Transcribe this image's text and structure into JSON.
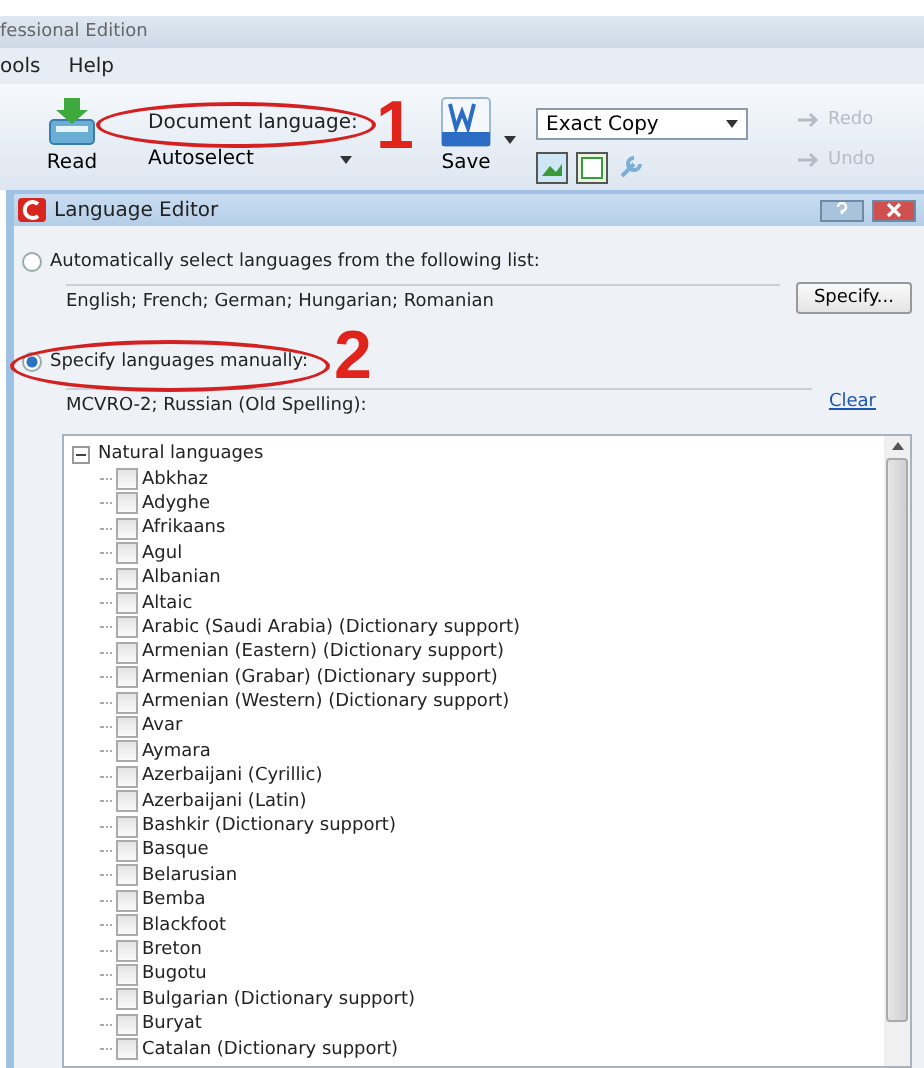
{
  "app_title": "fessional Edition",
  "menu": [
    {
      "label": "ools"
    },
    {
      "label": "Help"
    }
  ],
  "toolbar": {
    "read": {
      "label": "Read"
    },
    "language": {
      "label": "Document language:",
      "value": "Autoselect",
      "callout": "1"
    },
    "save": {
      "label": "Save"
    },
    "mode": {
      "value": "Exact Copy"
    },
    "history": [
      {
        "label": "Redo",
        "disabled": true
      },
      {
        "label": "Undo",
        "disabled": true
      }
    ]
  },
  "dialog": {
    "title": "Language Editor",
    "auto_option": {
      "label": "Automatically select languages from the following list:",
      "selected": false,
      "languages": "English; French; German; Hungarian; Romanian",
      "button": "Specify..."
    },
    "manual_option": {
      "label": "Specify languages manually:",
      "selected": true,
      "languages": "MCVRO-2; Russian (Old Spelling):",
      "link": "Clear",
      "callout": "2"
    },
    "tree": {
      "label": "Natural languages",
      "expanded": true,
      "children": [
        {
          "label": "Abkhaz",
          "checked": false
        },
        {
          "label": "Adyghe",
          "checked": false
        },
        {
          "label": "Afrikaans",
          "checked": false
        },
        {
          "label": "Agul",
          "checked": false
        },
        {
          "label": "Albanian",
          "checked": false
        },
        {
          "label": "Altaic",
          "checked": false
        },
        {
          "label": "Arabic (Saudi Arabia) (Dictionary support)",
          "checked": false
        },
        {
          "label": "Armenian (Eastern) (Dictionary support)",
          "checked": false
        },
        {
          "label": "Armenian (Grabar) (Dictionary support)",
          "checked": false
        },
        {
          "label": "Armenian (Western) (Dictionary support)",
          "checked": false
        },
        {
          "label": "Avar",
          "checked": false
        },
        {
          "label": "Aymara",
          "checked": false
        },
        {
          "label": "Azerbaijani (Cyrillic)",
          "checked": false
        },
        {
          "label": "Azerbaijani (Latin)",
          "checked": false
        },
        {
          "label": "Bashkir (Dictionary support)",
          "checked": false
        },
        {
          "label": "Basque",
          "checked": false
        },
        {
          "label": "Belarusian",
          "checked": false
        },
        {
          "label": "Bemba",
          "checked": false
        },
        {
          "label": "Blackfoot",
          "checked": false
        },
        {
          "label": "Breton",
          "checked": false
        },
        {
          "label": "Bugotu",
          "checked": false
        },
        {
          "label": "Bulgarian (Dictionary support)",
          "checked": false
        },
        {
          "label": "Buryat",
          "checked": false
        },
        {
          "label": "Catalan (Dictionary support)",
          "checked": false
        }
      ]
    }
  }
}
